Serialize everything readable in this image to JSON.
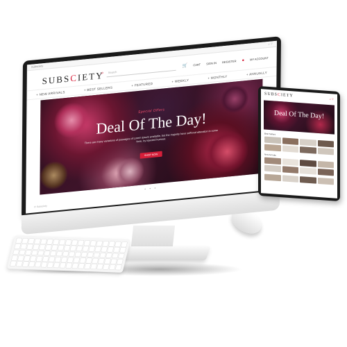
{
  "desktop": {
    "topbar": {
      "left": "Subsciety",
      "right": "⌕ ♡"
    },
    "logo": {
      "pre": "SUBS",
      "accent": "C",
      "post": "IETY"
    },
    "search": {
      "placeholder": "Search"
    },
    "actions": {
      "cart": "CART",
      "signin": "SIGN IN",
      "register": "REGISTER",
      "account": "MY ACCOUNT"
    },
    "nav": [
      "+ NEW ARRIVALS",
      "+ BEST SELLERS",
      "+ FEATURED",
      "+ WEEKLY",
      "+ MONTHLY",
      "+ ANNUALLY"
    ],
    "hero": {
      "badge": "Special Offers",
      "title": "Deal Of The Day!",
      "subtitle": "There are many variations of passages of Lorem Ipsum available, but the majority have suffered alteration in some form, by injected humour.",
      "button": "SHOP NOW"
    },
    "pagination": "• • •",
    "footer": "© Subsciety"
  },
  "tablet": {
    "logo": {
      "pre": "SUBS",
      "accent": "C",
      "post": "IETY"
    },
    "icons": "⌕ ♡",
    "hero_title": "Deal Of The Day!",
    "sections": [
      "Best Sellers",
      "New Arrivals"
    ]
  },
  "colors": {
    "accent": "#d61f3a"
  }
}
